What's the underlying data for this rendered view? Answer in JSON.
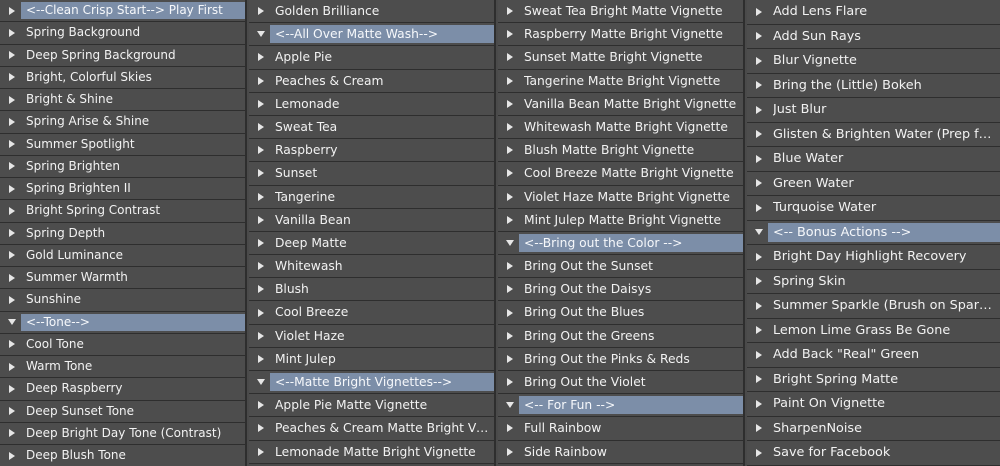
{
  "columns": [
    {
      "items": [
        {
          "label": "<--Clean Crisp Start--> Play First",
          "group": true,
          "expanded": false
        },
        {
          "label": "Spring Background"
        },
        {
          "label": "Deep Spring Background"
        },
        {
          "label": "Bright, Colorful Skies"
        },
        {
          "label": "Bright  & Shine"
        },
        {
          "label": "Spring Arise & Shine"
        },
        {
          "label": "Summer Spotlight"
        },
        {
          "label": "Spring Brighten"
        },
        {
          "label": "Spring Brighten II"
        },
        {
          "label": "Bright Spring Contrast"
        },
        {
          "label": "Spring Depth"
        },
        {
          "label": "Gold Luminance"
        },
        {
          "label": "Summer Warmth"
        },
        {
          "label": "Sunshine"
        },
        {
          "label": "<--Tone-->",
          "group": true,
          "expanded": true
        },
        {
          "label": "Cool Tone"
        },
        {
          "label": "Warm Tone"
        },
        {
          "label": "Deep Raspberry"
        },
        {
          "label": "Deep Sunset Tone"
        },
        {
          "label": "Deep Bright Day Tone (Contrast)"
        },
        {
          "label": "Deep Blush Tone"
        }
      ]
    },
    {
      "items": [
        {
          "label": "Golden Brilliance"
        },
        {
          "label": "<--All Over Matte Wash-->",
          "group": true,
          "expanded": true
        },
        {
          "label": "Apple Pie"
        },
        {
          "label": "Peaches & Cream"
        },
        {
          "label": "Lemonade"
        },
        {
          "label": "Sweat Tea"
        },
        {
          "label": "Raspberry"
        },
        {
          "label": "Sunset"
        },
        {
          "label": "Tangerine"
        },
        {
          "label": "Vanilla Bean"
        },
        {
          "label": "Deep Matte"
        },
        {
          "label": "Whitewash"
        },
        {
          "label": "Blush"
        },
        {
          "label": "Cool Breeze"
        },
        {
          "label": "Violet Haze"
        },
        {
          "label": "Mint Julep"
        },
        {
          "label": "<--Matte Bright Vignettes-->",
          "group": true,
          "expanded": true
        },
        {
          "label": "Apple Pie Matte Vignette"
        },
        {
          "label": "Peaches & Cream Matte Bright Vignette"
        },
        {
          "label": "Lemonade Matte Bright Vignette"
        }
      ]
    },
    {
      "items": [
        {
          "label": "Sweat Tea Bright Matte Vignette"
        },
        {
          "label": "Raspberry Matte Bright Vignette"
        },
        {
          "label": "Sunset Matte Bright Vignette"
        },
        {
          "label": "Tangerine Matte Bright Vignette"
        },
        {
          "label": "Vanilla Bean Matte Bright Vignette"
        },
        {
          "label": "Whitewash Matte Bright Vignette"
        },
        {
          "label": "Blush Matte Bright Vignette"
        },
        {
          "label": "Cool Breeze Matte Bright Vignette"
        },
        {
          "label": "Violet Haze Matte Bright Vignette"
        },
        {
          "label": "Mint Julep Matte Bright Vignette"
        },
        {
          "label": "<--Bring out the Color -->",
          "group": true,
          "expanded": true
        },
        {
          "label": "Bring Out the Sunset"
        },
        {
          "label": "Bring Out the Daisys"
        },
        {
          "label": "Bring Out the Blues"
        },
        {
          "label": "Bring Out the Greens"
        },
        {
          "label": "Bring Out the Pinks & Reds"
        },
        {
          "label": "Bring Out the Violet"
        },
        {
          "label": "<-- For Fun -->",
          "group": true,
          "expanded": true
        },
        {
          "label": "Full Rainbow"
        },
        {
          "label": "Side Rainbow"
        }
      ]
    },
    {
      "items": [
        {
          "label": "Add Lens Flare"
        },
        {
          "label": "Add Sun Rays"
        },
        {
          "label": "Blur Vignette"
        },
        {
          "label": "Bring the (Little) Bokeh"
        },
        {
          "label": "Just Blur"
        },
        {
          "label": "Glisten & Brighten Water (Prep for Color)"
        },
        {
          "label": "Blue Water"
        },
        {
          "label": "Green Water"
        },
        {
          "label": "Turquoise Water"
        },
        {
          "label": "<-- Bonus Actions -->",
          "group": true,
          "expanded": true
        },
        {
          "label": "Bright Day Highlight Recovery"
        },
        {
          "label": "Spring Skin"
        },
        {
          "label": "Summer Sparkle (Brush on Sparkle)"
        },
        {
          "label": "Lemon Lime Grass Be Gone"
        },
        {
          "label": "Add Back \"Real\" Green"
        },
        {
          "label": "Bright Spring Matte"
        },
        {
          "label": "Paint On Vignette"
        },
        {
          "label": "SharpenNoise"
        },
        {
          "label": "Save for Facebook"
        }
      ]
    }
  ],
  "colors": {
    "background": "#4a4a4a",
    "row": "#4d4d4d",
    "group_highlight": "#7c8ea8",
    "divider": "#2e2e2e",
    "text": "#f2f2f2"
  }
}
